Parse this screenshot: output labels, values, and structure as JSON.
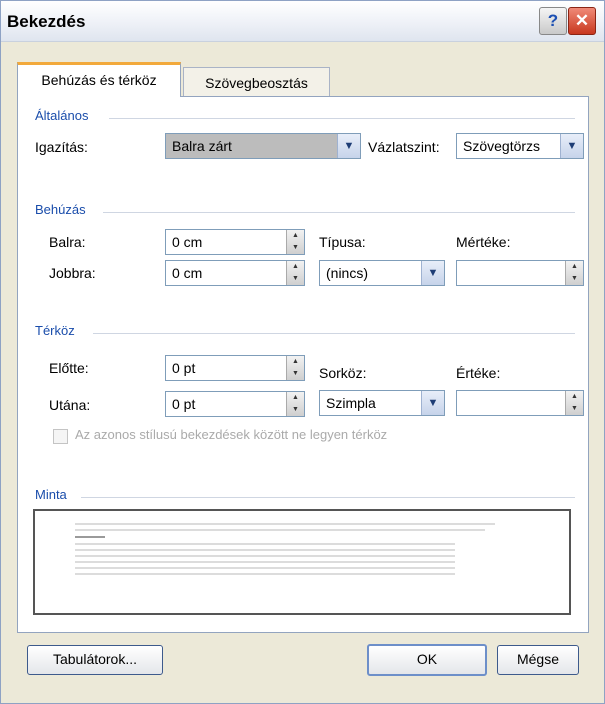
{
  "window": {
    "title": "Bekezdés",
    "help_label": "?",
    "close_label": "✕"
  },
  "tabs": [
    {
      "label": "Behúzás és térköz"
    },
    {
      "label": "Szövegbeosztás"
    }
  ],
  "general": {
    "heading": "Általános",
    "alignment_label": "Igazítás:",
    "alignment_value": "Balra zárt",
    "outline_label": "Vázlatszint:",
    "outline_value": "Szövegtörzs"
  },
  "indent": {
    "heading": "Behúzás",
    "left_label": "Balra:",
    "left_value": "0 cm",
    "right_label": "Jobbra:",
    "right_value": "0 cm",
    "type_label": "Típusa:",
    "type_value": "(nincs)",
    "amount_label": "Mértéke:",
    "amount_value": ""
  },
  "spacing": {
    "heading": "Térköz",
    "before_label": "Előtte:",
    "before_value": "0 pt",
    "after_label": "Utána:",
    "after_value": "0 pt",
    "line_label": "Sorköz:",
    "line_value": "Szimpla",
    "at_label": "Értéke:",
    "at_value": "",
    "no_space_label": "Az azonos stílusú bekezdések között ne legyen térköz"
  },
  "preview": {
    "heading": "Minta"
  },
  "buttons": {
    "tabs_label": "Tabulátorok...",
    "ok_label": "OK",
    "cancel_label": "Mégse"
  },
  "colors": {
    "section_heading": "#1a4dab",
    "active_tab_accent": "#f2a93b"
  }
}
